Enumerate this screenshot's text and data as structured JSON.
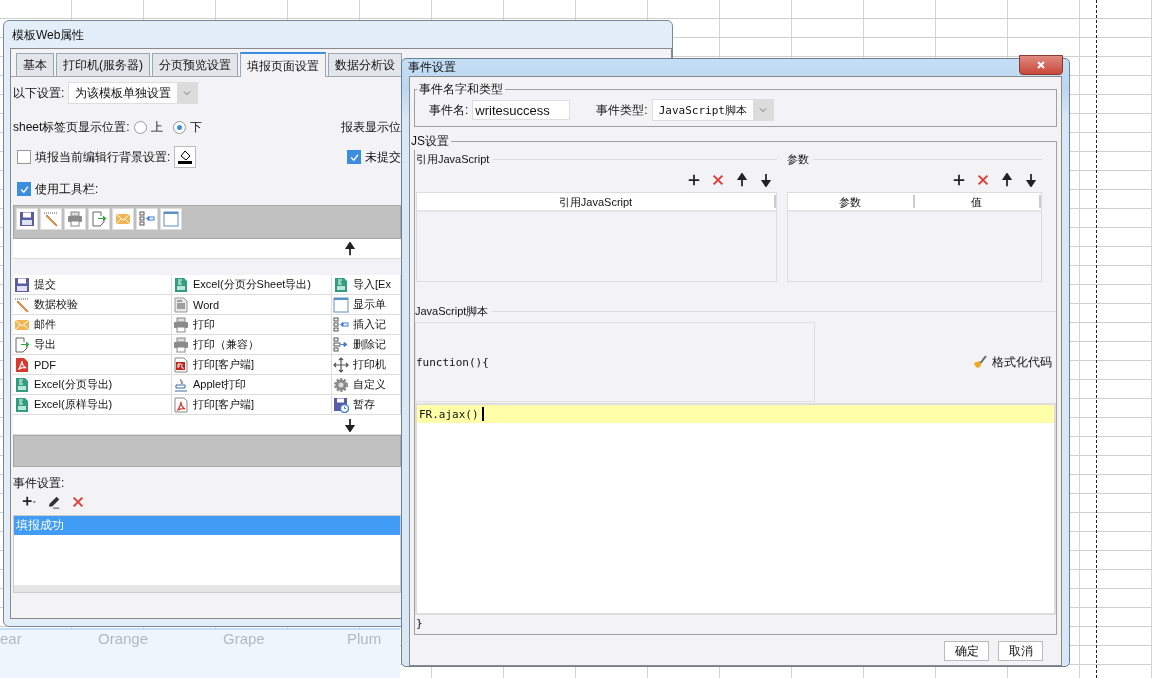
{
  "window": {
    "title": "模板Web属性"
  },
  "tabs": [
    {
      "label": "基本",
      "selected": false
    },
    {
      "label": "打印机(服务器)",
      "selected": false
    },
    {
      "label": "分页预览设置",
      "selected": false
    },
    {
      "label": "填报页面设置",
      "selected": true
    },
    {
      "label": "数据分析设",
      "selected": false
    }
  ],
  "settings_scope": {
    "label": "以下设置:",
    "value": "为该模板单独设置"
  },
  "sheet_tab_position": {
    "label": "sheet标签页显示位置:",
    "options": [
      {
        "label": "上",
        "selected": false
      },
      {
        "label": "下",
        "selected": true
      }
    ]
  },
  "report_display_label": "报表显示位",
  "row_background": {
    "label": "填报当前编辑行背景设置:",
    "checked": false
  },
  "unsubmitted": {
    "label": "未提交",
    "checked": true
  },
  "use_toolbar": {
    "label": "使用工具栏:",
    "checked": true
  },
  "available_buttons": [
    [
      "提交",
      "Excel(分页分Sheet导出)",
      "导入[Ex"
    ],
    [
      "数据校验",
      "Word",
      "显示单"
    ],
    [
      "邮件",
      "打印",
      "插入记"
    ],
    [
      "导出",
      "打印（兼容）",
      "删除记"
    ],
    [
      "PDF",
      "打印[客户端]",
      "打印机"
    ],
    [
      "Excel(分页导出)",
      "Applet打印",
      "自定义"
    ],
    [
      "Excel(原样导出)",
      "打印[客户端]",
      "暂存"
    ]
  ],
  "events": {
    "label": "事件设置:",
    "items": [
      {
        "label": "填报成功",
        "selected": true
      }
    ]
  },
  "dialog": {
    "title": "事件设置",
    "name_group": {
      "title": "事件名字和类型",
      "name_label": "事件名:",
      "name_value": "writesuccess",
      "type_label": "事件类型:",
      "type_value": "JavaScript脚本"
    },
    "js_group": {
      "title": "JS设置",
      "references": {
        "title": "引用JavaScript",
        "columns": [
          "引用JavaScript"
        ]
      },
      "parameters": {
        "title": "参数",
        "columns": [
          "参数",
          "值"
        ]
      },
      "script": {
        "title": "JavaScript脚本",
        "header": "function(){",
        "format_button": "格式化代码",
        "code": "FR.ajax()",
        "footer": "}"
      }
    },
    "buttons": [
      "确定",
      "取消"
    ]
  },
  "background": {
    "axis_labels": [
      "ear",
      "Orange",
      "Grape",
      "Plum"
    ]
  }
}
